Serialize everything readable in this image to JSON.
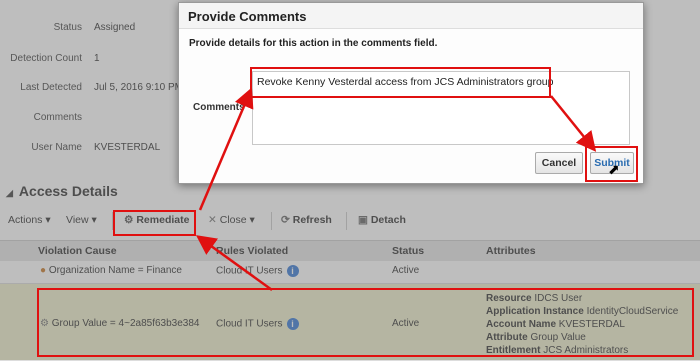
{
  "background": {
    "fields": [
      {
        "label": "Status",
        "value": "Assigned"
      },
      {
        "label": "Detection Count",
        "value": "1"
      },
      {
        "label": "Last Detected",
        "value": "Jul 5, 2016 9:10 PM"
      },
      {
        "label": "Comments",
        "value": ""
      },
      {
        "label": "User Name",
        "value": "KVESTERDAL"
      }
    ],
    "section_title": "Access Details",
    "toolbar": {
      "actions": "Actions ▾",
      "view": "View ▾",
      "remediate": "Remediate",
      "close": "Close ▾",
      "refresh": "Refresh",
      "detach": "Detach"
    },
    "grid": {
      "headers": [
        "Violation Cause",
        "Rules Violated",
        "Status",
        "Attributes"
      ],
      "rows": [
        {
          "cause": "Organization Name = Finance",
          "rules": "Cloud IT Users",
          "status": "Active"
        },
        {
          "cause": "Group Value = 4~2a85f63b3e384",
          "rules": "Cloud IT Users",
          "status": "Active",
          "attributes": [
            {
              "key": "Resource",
              "value": "IDCS User"
            },
            {
              "key": "Application Instance",
              "value": "IdentityCloudService"
            },
            {
              "key": "Account Name",
              "value": "KVESTERDAL"
            },
            {
              "key": "Attribute",
              "value": "Group Value"
            },
            {
              "key": "Entitlement",
              "value": "JCS Administrators"
            }
          ]
        }
      ]
    }
  },
  "dialog": {
    "title": "Provide Comments",
    "instruction": "Provide details for this action in the comments field.",
    "comments_label": "Comments",
    "comments_value": "Revoke Kenny Vesterdal access from JCS Administrators group",
    "cancel_label": "Cancel",
    "submit_label": "Submit"
  },
  "colors": {
    "highlight": "#e01010",
    "submit_text": "#2a6cb0",
    "info_icon": "#3a7bd5",
    "selected_row": "#eeeecc"
  }
}
